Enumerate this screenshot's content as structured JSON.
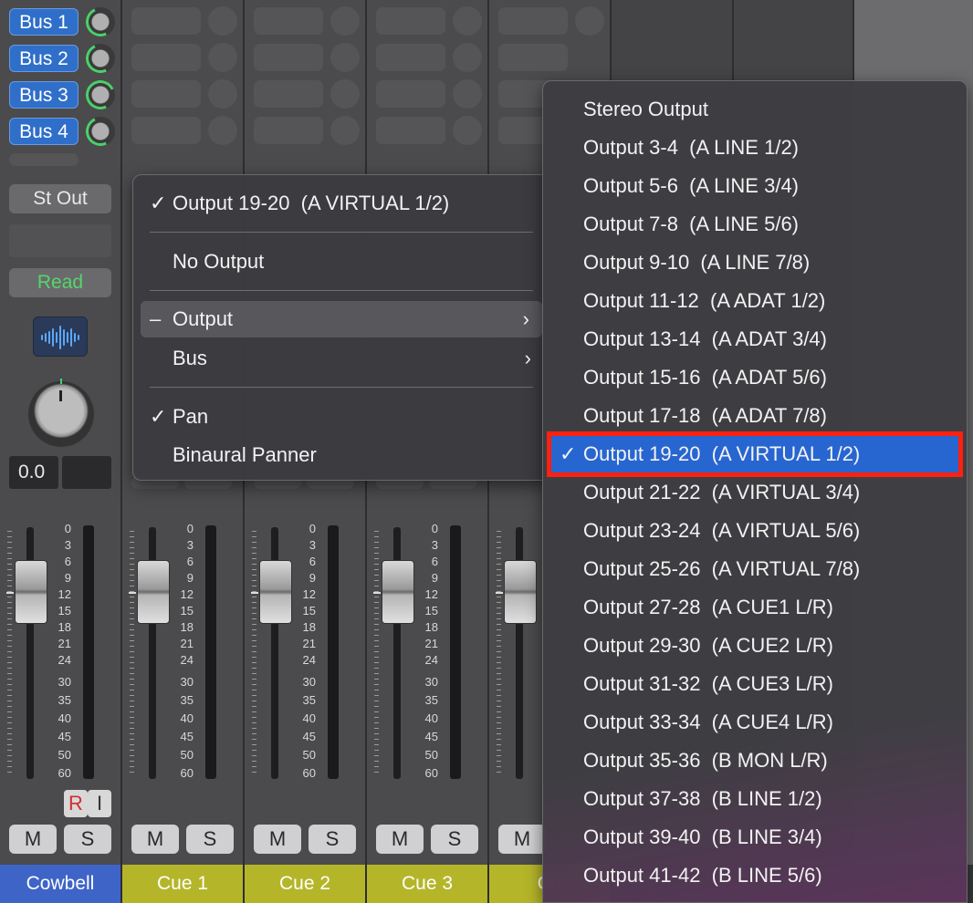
{
  "buses": [
    "Bus 1",
    "Bus 2",
    "Bus 3",
    "Bus 4"
  ],
  "output_button": "St Out",
  "automation_button": "Read",
  "volume_value": "0.0",
  "fader_scale": [
    "0",
    "3",
    "6",
    "9",
    "12",
    "15",
    "18",
    "21",
    "24",
    "30",
    "35",
    "40",
    "45",
    "50",
    "60"
  ],
  "record_label": "R",
  "input_label": "I",
  "mute_label": "M",
  "solo_label": "S",
  "channels": [
    {
      "name": "Cowbell",
      "color": "#3e64c8"
    },
    {
      "name": "Cue 1",
      "color": "#b5b52a"
    },
    {
      "name": "Cue 2",
      "color": "#b5b52a"
    },
    {
      "name": "Cue 3",
      "color": "#b5b52a"
    },
    {
      "name": "Cu",
      "color": "#b5b52a"
    }
  ],
  "output_menu": {
    "current": "Output 19-20  (A VIRTUAL 1/2)",
    "no_output": "No Output",
    "output": "Output",
    "bus": "Bus",
    "pan": "Pan",
    "binaural": "Binaural Panner",
    "check": "✓",
    "dash": "–",
    "arrow": "›"
  },
  "output_submenu": {
    "items": [
      "Stereo Output",
      "Output 3-4  (A LINE 1/2)",
      "Output 5-6  (A LINE 3/4)",
      "Output 7-8  (A LINE 5/6)",
      "Output 9-10  (A LINE 7/8)",
      "Output 11-12  (A ADAT 1/2)",
      "Output 13-14  (A ADAT 3/4)",
      "Output 15-16  (A ADAT 5/6)",
      "Output 17-18  (A ADAT 7/8)",
      "Output 19-20  (A VIRTUAL 1/2)",
      "Output 21-22  (A VIRTUAL 3/4)",
      "Output 23-24  (A VIRTUAL 5/6)",
      "Output 25-26  (A VIRTUAL 7/8)",
      "Output 27-28  (A CUE1 L/R)",
      "Output 29-30  (A CUE2 L/R)",
      "Output 31-32  (A CUE3 L/R)",
      "Output 33-34  (A CUE4 L/R)",
      "Output 35-36  (B MON L/R)",
      "Output 37-38  (B LINE 1/2)",
      "Output 39-40  (B LINE 3/4)",
      "Output 41-42  (B LINE 5/6)"
    ],
    "selected_index": 9,
    "check": "✓"
  }
}
